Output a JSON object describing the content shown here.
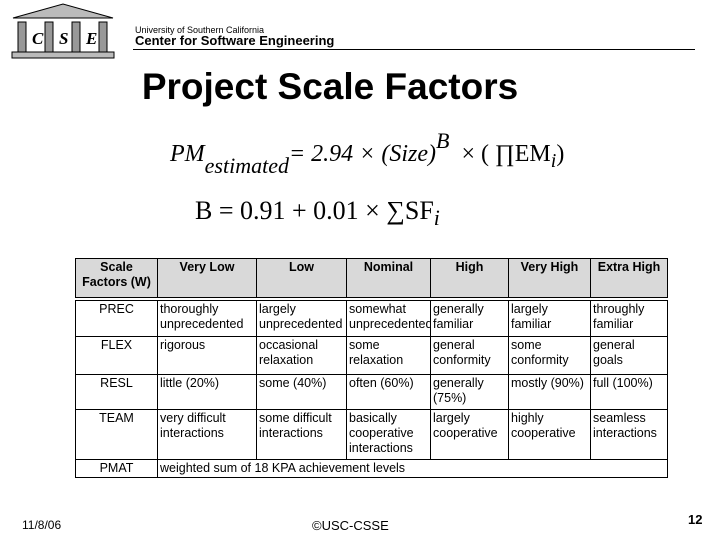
{
  "header": {
    "logo_letters": [
      "C",
      "S",
      "E"
    ],
    "university": "University of Southern California",
    "center": "Center for Software  Engineering"
  },
  "title": "Project Scale Factors",
  "formula1": {
    "lhs": "PM",
    "sub": "estimated",
    "rhs": "= 2.94 × (Size)",
    "exp": "B",
    "prod": "× ( ∏EM",
    "prod_sub": "i",
    ")": ")"
  },
  "formula2": {
    "text": "B  = 0.91 + 0.01 × ∑SF",
    "sub": "i"
  },
  "table": {
    "headers": [
      "Scale Factors (W)",
      "Very Low",
      "Low",
      "Nominal",
      "High",
      "Very High",
      "Extra High"
    ],
    "rows": [
      [
        "PREC",
        "thoroughly unprecedented",
        "largely unprecedented",
        "somewhat unprecedented",
        "generally familiar",
        "largely familiar",
        "throughly familiar"
      ],
      [
        "FLEX",
        "rigorous",
        "occasional relaxation",
        "some relaxation",
        "general conformity",
        "some conformity",
        "general goals"
      ],
      [
        "RESL",
        "little (20%)",
        "some (40%)",
        "often (60%)",
        "generally (75%)",
        "mostly (90%)",
        "full (100%)"
      ],
      [
        "TEAM",
        "very difficult interactions",
        "some difficult interactions",
        "basically cooperative interactions",
        "largely cooperative",
        "highly cooperative",
        "seamless interactions"
      ]
    ],
    "pmat": {
      "label": "PMAT",
      "text": "weighted sum of 18 KPA achievement levels"
    }
  },
  "footer": {
    "date": "11/8/06",
    "copyright": "©USC-CSSE",
    "page": "12"
  }
}
